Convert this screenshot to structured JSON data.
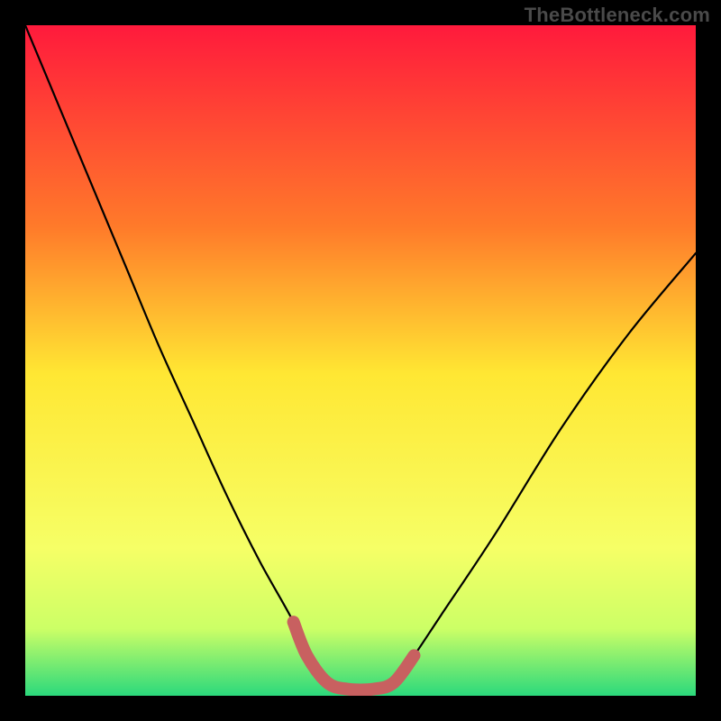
{
  "watermark": "TheBottleneck.com",
  "colors": {
    "gradient_top": "#ff1a3c",
    "gradient_mid_upper": "#ff7a2a",
    "gradient_mid": "#ffe733",
    "gradient_mid_lower": "#f6ff66",
    "gradient_lower": "#ccff66",
    "gradient_bottom": "#2bd97c",
    "curve": "#000000",
    "highlight": "#c86060",
    "frame": "#000000"
  },
  "chart_data": {
    "type": "line",
    "title": "",
    "xlabel": "",
    "ylabel": "",
    "xlim": [
      0,
      100
    ],
    "ylim": [
      0,
      100
    ],
    "series": [
      {
        "name": "bottleneck-curve",
        "x": [
          0,
          5,
          10,
          15,
          20,
          25,
          30,
          35,
          40,
          42,
          45,
          48,
          52,
          55,
          58,
          62,
          70,
          80,
          90,
          100
        ],
        "y": [
          100,
          88,
          76,
          64,
          52,
          41,
          30,
          20,
          11,
          6,
          2,
          1,
          1,
          2,
          6,
          12,
          24,
          40,
          54,
          66
        ]
      },
      {
        "name": "highlight-segment",
        "x": [
          40,
          42,
          45,
          48,
          52,
          55,
          58
        ],
        "y": [
          11,
          6,
          2,
          1,
          1,
          2,
          6
        ]
      }
    ],
    "annotations": []
  }
}
